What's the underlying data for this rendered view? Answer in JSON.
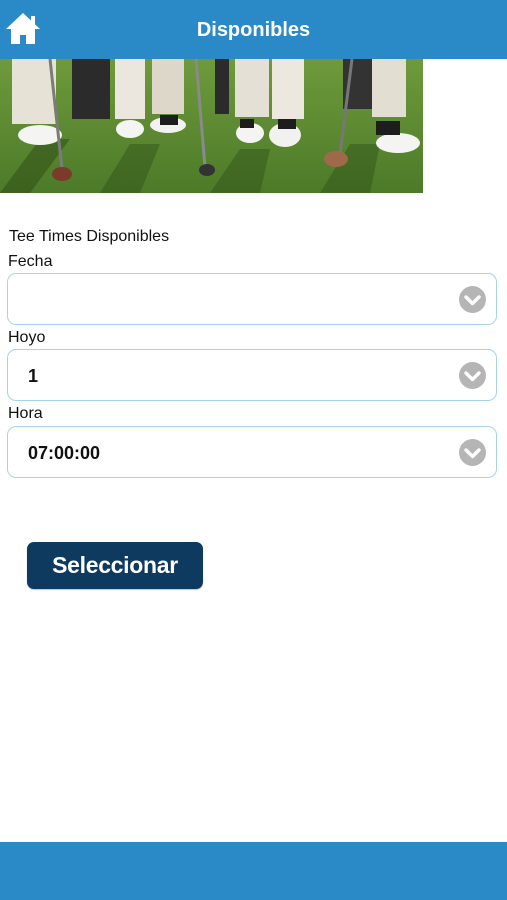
{
  "header": {
    "title": "Disponibles",
    "home_icon": "home-icon"
  },
  "section_title": "Tee Times Disponibles",
  "form": {
    "fecha": {
      "label": "Fecha",
      "value": ""
    },
    "hoyo": {
      "label": "Hoyo",
      "value": "1"
    },
    "hora": {
      "label": "Hora",
      "value": "07:00:00"
    }
  },
  "submit_label": "Seleccionar",
  "colors": {
    "header_bg": "#2a8ac7",
    "button_bg": "#0d3a5e",
    "field_border": "#a9d3ea",
    "chevron": "#b5b5b5"
  }
}
